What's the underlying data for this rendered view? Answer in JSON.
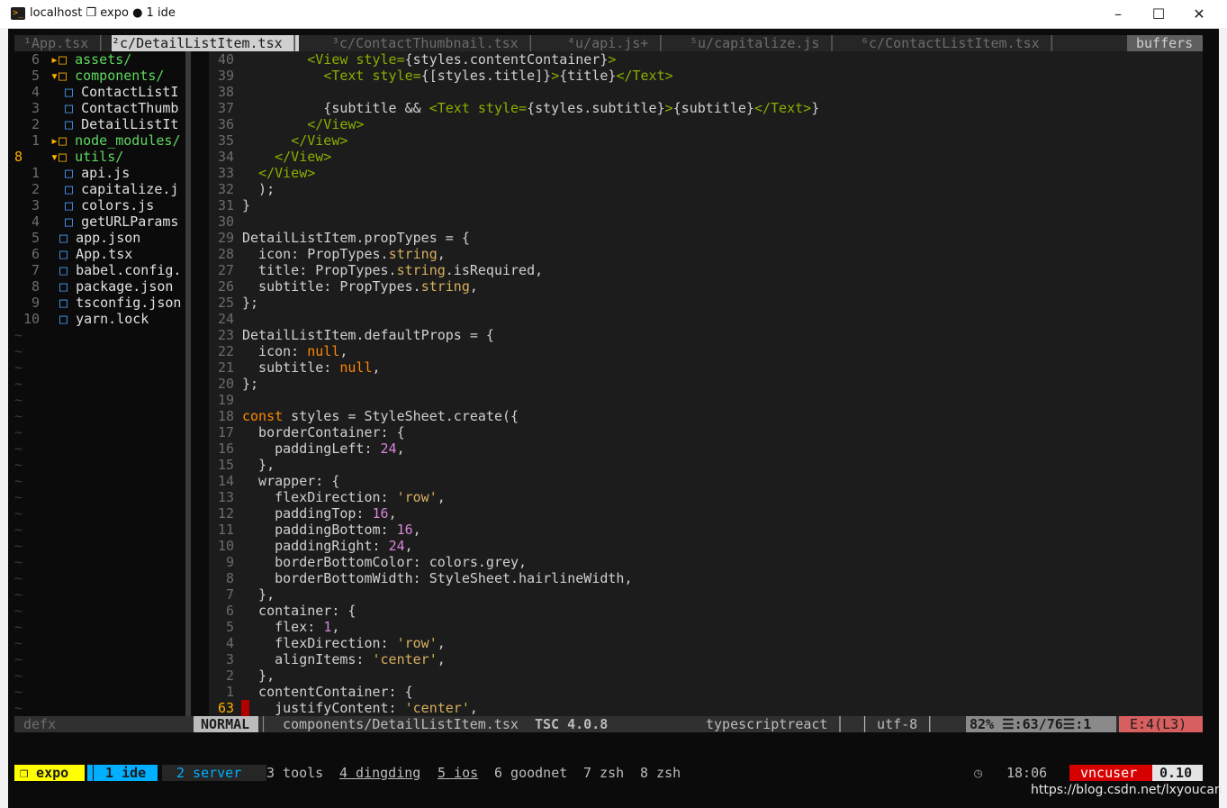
{
  "window": {
    "title": "localhost ❒ expo ● 1 ide",
    "controls": {
      "minimize": "–",
      "maximize": "☐",
      "close": "✕"
    }
  },
  "tabs": [
    {
      "label": "¹App.tsx │",
      "active": false
    },
    {
      "label": "²c/DetailListItem.tsx │",
      "active": true
    },
    {
      "label": "³c/ContactThumbnail.tsx │",
      "active": false
    },
    {
      "label": "⁴u/api.js+ │",
      "active": false
    },
    {
      "label": "⁵u/capitalize.js │",
      "active": false
    },
    {
      "label": "⁶c/ContactListItem.tsx │",
      "active": false
    }
  ],
  "buffers_label": "buffers",
  "tree": {
    "items": [
      {
        "num": "6",
        "arrow": "▸",
        "icon": "□",
        "name": "assets/",
        "kind": "dir",
        "indent": 0
      },
      {
        "num": "5",
        "arrow": "▾",
        "icon": "□",
        "name": "components/",
        "kind": "dir",
        "indent": 0
      },
      {
        "num": "4",
        "arrow": "",
        "icon": "□",
        "name": "ContactListI",
        "kind": "file",
        "indent": 1
      },
      {
        "num": "3",
        "arrow": "",
        "icon": "□",
        "name": "ContactThumb",
        "kind": "file",
        "indent": 1
      },
      {
        "num": "2",
        "arrow": "",
        "icon": "□",
        "name": "DetailListIt",
        "kind": "file",
        "indent": 1
      },
      {
        "num": "1",
        "arrow": "▸",
        "icon": "□",
        "name": "node_modules/",
        "kind": "dir",
        "indent": 0
      },
      {
        "num": "8",
        "arrow": "▾",
        "icon": "□",
        "name": "utils/",
        "kind": "dir",
        "indent": 0,
        "current": true
      },
      {
        "num": "1",
        "arrow": "",
        "icon": "□",
        "name": "api.js",
        "kind": "file",
        "indent": 1
      },
      {
        "num": "2",
        "arrow": "",
        "icon": "□",
        "name": "capitalize.j",
        "kind": "file",
        "indent": 1
      },
      {
        "num": "3",
        "arrow": "",
        "icon": "□",
        "name": "colors.js",
        "kind": "file",
        "indent": 1
      },
      {
        "num": "4",
        "arrow": "",
        "icon": "□",
        "name": "getURLParams",
        "kind": "file",
        "indent": 1
      },
      {
        "num": "5",
        "arrow": "",
        "icon": "□",
        "name": "app.json",
        "kind": "file",
        "indent": 0
      },
      {
        "num": "6",
        "arrow": "",
        "icon": "□",
        "name": "App.tsx",
        "kind": "file",
        "indent": 0
      },
      {
        "num": "7",
        "arrow": "",
        "icon": "□",
        "name": "babel.config.",
        "kind": "file",
        "indent": 0
      },
      {
        "num": "8",
        "arrow": "",
        "icon": "□",
        "name": "package.json",
        "kind": "file",
        "indent": 0
      },
      {
        "num": "9",
        "arrow": "",
        "icon": "□",
        "name": "tsconfig.json",
        "kind": "file",
        "indent": 0
      },
      {
        "num": "10",
        "arrow": "",
        "icon": "□",
        "name": "yarn.lock",
        "kind": "file",
        "indent": 0
      }
    ],
    "tilde": "~"
  },
  "code": [
    {
      "n": "40",
      "segs": [
        [
          "p",
          "        "
        ],
        [
          "tag",
          "<View "
        ],
        [
          "tag",
          "style="
        ],
        [
          "p",
          "{styles.contentContainer}"
        ],
        [
          "tag",
          ">"
        ]
      ]
    },
    {
      "n": "39",
      "segs": [
        [
          "p",
          "          "
        ],
        [
          "tag",
          "<Text "
        ],
        [
          "tag",
          "style="
        ],
        [
          "p",
          "{[styles.title]}"
        ],
        [
          "tag",
          ">"
        ],
        [
          "p",
          "{title}"
        ],
        [
          "tag",
          "</Text>"
        ]
      ]
    },
    {
      "n": "38",
      "segs": []
    },
    {
      "n": "37",
      "segs": [
        [
          "p",
          "          {subtitle && "
        ],
        [
          "tag",
          "<Text "
        ],
        [
          "tag",
          "style="
        ],
        [
          "p",
          "{styles.subtitle}"
        ],
        [
          "tag",
          ">"
        ],
        [
          "p",
          "{subtitle}"
        ],
        [
          "tag",
          "</Text>"
        ],
        [
          "p",
          "}"
        ]
      ]
    },
    {
      "n": "36",
      "segs": [
        [
          "p",
          "        "
        ],
        [
          "tag",
          "</View>"
        ]
      ]
    },
    {
      "n": "35",
      "segs": [
        [
          "p",
          "      "
        ],
        [
          "tag",
          "</View>"
        ]
      ]
    },
    {
      "n": "34",
      "segs": [
        [
          "p",
          "    "
        ],
        [
          "tag",
          "</View>"
        ]
      ]
    },
    {
      "n": "33",
      "segs": [
        [
          "p",
          "  "
        ],
        [
          "tag",
          "</View>"
        ]
      ]
    },
    {
      "n": "32",
      "segs": [
        [
          "p",
          "  );"
        ]
      ]
    },
    {
      "n": "31",
      "segs": [
        [
          "p",
          "}"
        ]
      ]
    },
    {
      "n": "30",
      "segs": []
    },
    {
      "n": "29",
      "segs": [
        [
          "p",
          "DetailListItem.propTypes = {"
        ]
      ]
    },
    {
      "n": "28",
      "segs": [
        [
          "p",
          "  icon: PropTypes."
        ],
        [
          "str",
          "string"
        ],
        [
          "p",
          ","
        ]
      ]
    },
    {
      "n": "27",
      "segs": [
        [
          "p",
          "  title: PropTypes."
        ],
        [
          "str",
          "string"
        ],
        [
          "p",
          ".isRequired,"
        ]
      ]
    },
    {
      "n": "26",
      "segs": [
        [
          "p",
          "  subtitle: PropTypes."
        ],
        [
          "str",
          "string"
        ],
        [
          "p",
          ","
        ]
      ]
    },
    {
      "n": "25",
      "segs": [
        [
          "p",
          "};"
        ]
      ]
    },
    {
      "n": "24",
      "segs": []
    },
    {
      "n": "23",
      "segs": [
        [
          "p",
          "DetailListItem.defaultProps = {"
        ]
      ]
    },
    {
      "n": "22",
      "segs": [
        [
          "p",
          "  icon: "
        ],
        [
          "kw",
          "null"
        ],
        [
          "p",
          ","
        ]
      ]
    },
    {
      "n": "21",
      "segs": [
        [
          "p",
          "  subtitle: "
        ],
        [
          "kw",
          "null"
        ],
        [
          "p",
          ","
        ]
      ]
    },
    {
      "n": "20",
      "segs": [
        [
          "p",
          "};"
        ]
      ]
    },
    {
      "n": "19",
      "segs": []
    },
    {
      "n": "18",
      "segs": [
        [
          "kw",
          "const"
        ],
        [
          "p",
          " styles = StyleSheet.create({"
        ]
      ]
    },
    {
      "n": "17",
      "segs": [
        [
          "p",
          "  borderContainer: {"
        ]
      ]
    },
    {
      "n": "16",
      "segs": [
        [
          "p",
          "    paddingLeft: "
        ],
        [
          "num",
          "24"
        ],
        [
          "p",
          ","
        ]
      ]
    },
    {
      "n": "15",
      "segs": [
        [
          "p",
          "  },"
        ]
      ]
    },
    {
      "n": "14",
      "segs": [
        [
          "p",
          "  wrapper: {"
        ]
      ]
    },
    {
      "n": "13",
      "segs": [
        [
          "p",
          "    flexDirection: "
        ],
        [
          "str",
          "'row'"
        ],
        [
          "p",
          ","
        ]
      ]
    },
    {
      "n": "12",
      "segs": [
        [
          "p",
          "    paddingTop: "
        ],
        [
          "num",
          "16"
        ],
        [
          "p",
          ","
        ]
      ]
    },
    {
      "n": "11",
      "segs": [
        [
          "p",
          "    paddingBottom: "
        ],
        [
          "num",
          "16"
        ],
        [
          "p",
          ","
        ]
      ]
    },
    {
      "n": "10",
      "segs": [
        [
          "p",
          "    paddingRight: "
        ],
        [
          "num",
          "24"
        ],
        [
          "p",
          ","
        ]
      ]
    },
    {
      "n": "9",
      "segs": [
        [
          "p",
          "    borderBottomColor: colors.grey,"
        ]
      ]
    },
    {
      "n": "8",
      "segs": [
        [
          "p",
          "    borderBottomWidth: StyleSheet.hairlineWidth,"
        ]
      ]
    },
    {
      "n": "7",
      "segs": [
        [
          "p",
          "  },"
        ]
      ]
    },
    {
      "n": "6",
      "segs": [
        [
          "p",
          "  container: {"
        ]
      ]
    },
    {
      "n": "5",
      "segs": [
        [
          "p",
          "    flex: "
        ],
        [
          "num",
          "1"
        ],
        [
          "p",
          ","
        ]
      ]
    },
    {
      "n": "4",
      "segs": [
        [
          "p",
          "    flexDirection: "
        ],
        [
          "str",
          "'row'"
        ],
        [
          "p",
          ","
        ]
      ]
    },
    {
      "n": "3",
      "segs": [
        [
          "p",
          "    alignItems: "
        ],
        [
          "str",
          "'center'"
        ],
        [
          "p",
          ","
        ]
      ]
    },
    {
      "n": "2",
      "segs": [
        [
          "p",
          "  },"
        ]
      ]
    },
    {
      "n": "1",
      "segs": [
        [
          "p",
          "  contentContainer: {"
        ]
      ]
    },
    {
      "n": "63",
      "current": true,
      "segs": [
        [
          "p",
          "    justifyContent: "
        ],
        [
          "str",
          "'center'"
        ],
        [
          "p",
          ","
        ]
      ]
    }
  ],
  "statusline": {
    "tree_name": "defx",
    "mode": "NORMAL",
    "sep1": "│",
    "file": "components/DetailListItem.tsx",
    "tsc": "TSC 4.0.8",
    "filetype": "typescriptreact │",
    "encoding": "│ utf-8 │",
    "position": "82% ☰:63/76☰:1",
    "errors": "E:4(L3)"
  },
  "tmux": {
    "session": "❒ expo",
    "windows": [
      {
        "label": "│ 1 ide",
        "state": "active"
      },
      {
        "label": "2 server",
        "state": "last"
      },
      {
        "label": "3 tools",
        "state": "normal"
      },
      {
        "label": "4 dingding",
        "state": "activity"
      },
      {
        "label": "5 ios",
        "state": "activity"
      },
      {
        "label": "6 goodnet",
        "state": "normal"
      },
      {
        "label": "7 zsh",
        "state": "normal"
      },
      {
        "label": "8 zsh",
        "state": "normal"
      }
    ],
    "clock_icon": "◷",
    "time": "18:06",
    "user": "vncuser",
    "load": "0.10"
  },
  "watermark": "https://blog.csdn.net/lxyoucan",
  "colors": {
    "accent_orange": "#ffaf00",
    "tmux_session_bg": "#ffff00",
    "tmux_active_bg": "#00afff",
    "tmux_user_bg": "#d70000",
    "error_bg": "#d75f5f"
  }
}
